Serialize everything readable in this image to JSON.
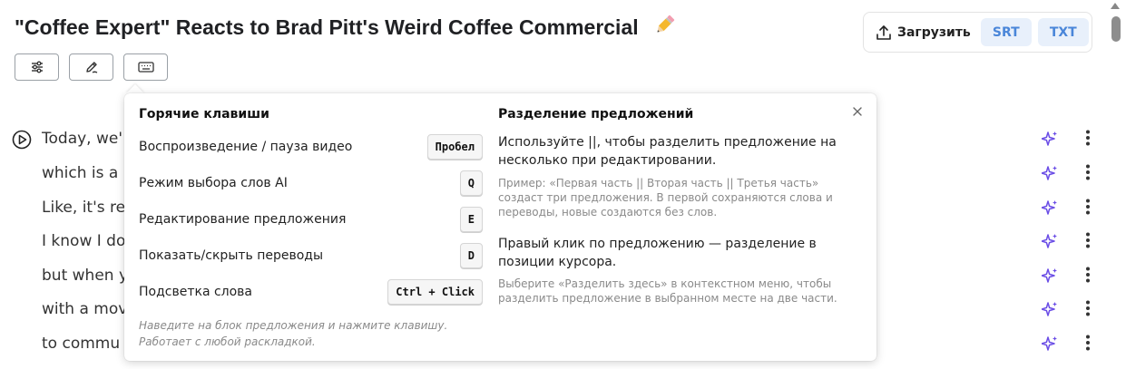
{
  "header": {
    "title": "\"Coffee Expert\" Reacts to Brad Pitt's Weird Coffee Commercial",
    "title_icon": "pencil-emoji"
  },
  "toolbar": {
    "buttons": [
      {
        "name": "settings-sliders-icon"
      },
      {
        "name": "edit-pen-icon"
      },
      {
        "name": "keyboard-icon"
      }
    ]
  },
  "upload": {
    "label": "Загрузить",
    "formats": [
      "SRT",
      "TXT"
    ]
  },
  "transcript": {
    "lines": [
      "Today, we'",
      "which is a",
      "Like, it's re",
      "I know I do",
      "but when y",
      "with a mov",
      "to commu"
    ]
  },
  "popup": {
    "hotkeys_title": "Горячие клавиши",
    "hotkeys": [
      {
        "label": "Воспроизведение / пауза видео",
        "key": "Пробел"
      },
      {
        "label": "Режим выбора слов AI",
        "key": "Q"
      },
      {
        "label": "Редактирование предложения",
        "key": "E"
      },
      {
        "label": "Показать/скрыть переводы",
        "key": "D"
      },
      {
        "label": "Подсветка слова",
        "key": "Ctrl + Click"
      }
    ],
    "hint": "Наведите на блок предложения и нажмите клавишу. Работает с любой раскладкой.",
    "split_title": "Разделение предложений",
    "split_main": "Используйте ||, чтобы разделить предложение на несколько при редактировании.",
    "split_example": "Пример: «Первая часть || Вторая часть || Третья часть» создаст три предложения. В первой сохраняются слова и переводы, новые создаются без слов.",
    "rightclick_main": "Правый клик по предложению — разделение в позиции курсора.",
    "rightclick_sub": "Выберите «Разделить здесь» в контекстном меню, чтобы разделить предложение в выбранном месте на две части."
  },
  "colors": {
    "accent_purple": "#6b4ee6",
    "format_bg": "#e8f0fb",
    "format_text": "#4a86d9"
  }
}
